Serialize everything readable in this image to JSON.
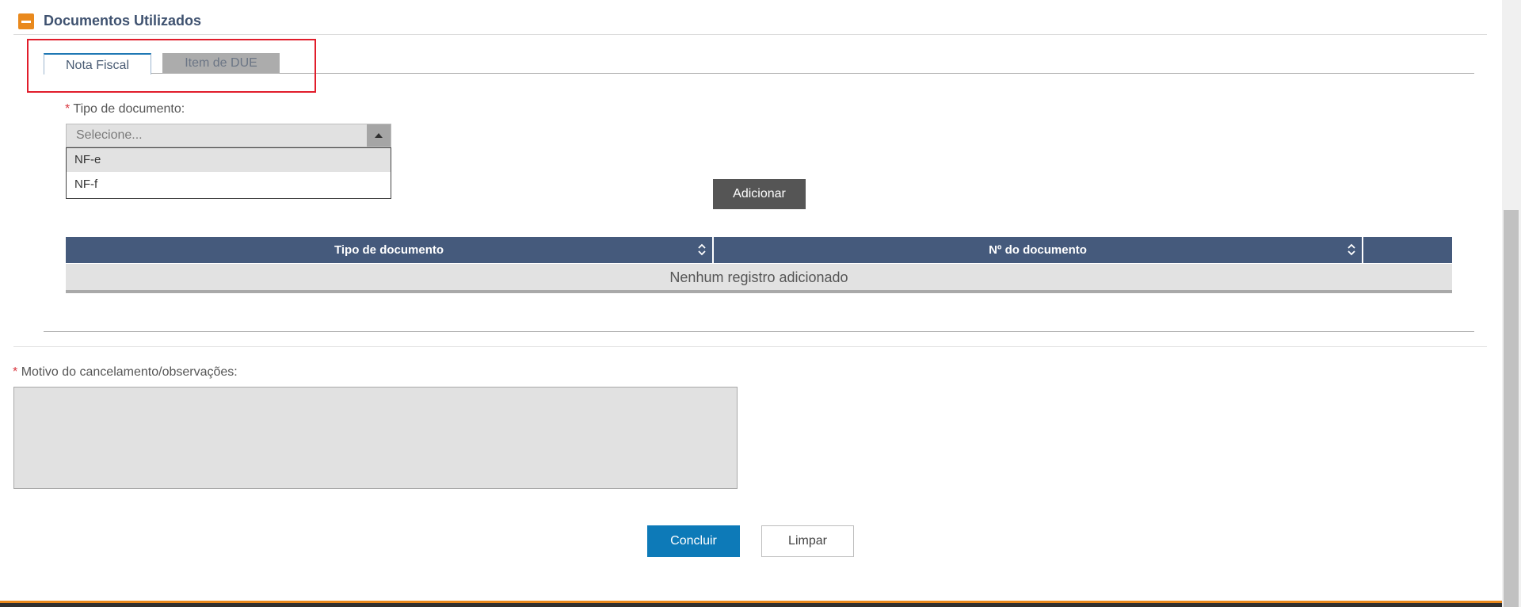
{
  "section": {
    "title": "Documentos Utilizados",
    "toggle_icon": "collapse-minus-icon"
  },
  "tabs": [
    {
      "label": "Nota Fiscal",
      "active": true
    },
    {
      "label": "Item de DUE",
      "active": false
    }
  ],
  "tipo_documento": {
    "required_mark": "*",
    "label": "Tipo de documento:",
    "placeholder": "Selecione...",
    "options": [
      "NF-e",
      "NF-f"
    ],
    "highlighted_option": "NF-e"
  },
  "add_button": {
    "label": "Adicionar"
  },
  "table": {
    "columns": [
      "Tipo de documento",
      "Nº do documento",
      ""
    ],
    "empty_message": "Nenhum registro adicionado"
  },
  "motivo": {
    "required_mark": "*",
    "label": "Motivo do cancelamento/observações:",
    "value": ""
  },
  "actions": {
    "concluir": "Concluir",
    "limpar": "Limpar"
  },
  "colors": {
    "accent_orange": "#e9891d",
    "header_blue": "#455a7c",
    "primary_button": "#0d7ab8",
    "highlight_red": "#e11d2b"
  }
}
